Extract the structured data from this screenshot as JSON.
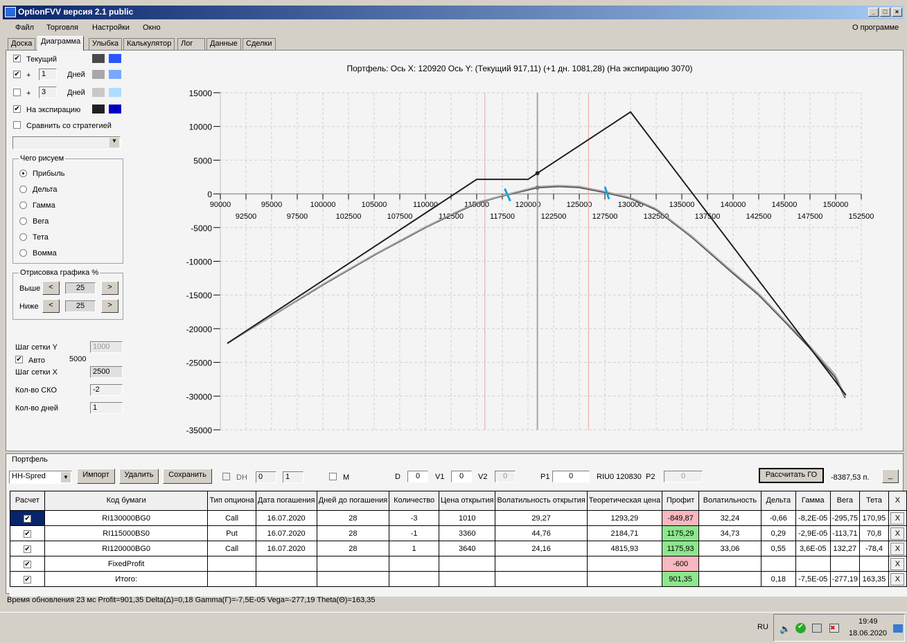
{
  "window": {
    "title": "OptionFVV версия 2.1 public",
    "min": "_",
    "max": "□",
    "close": "×"
  },
  "menu": [
    "Файл",
    "Торговля",
    "Настройки",
    "Окно"
  ],
  "about": "О программе",
  "tabs": [
    "Доска",
    "Диаграмма",
    "Улыбка",
    "Калькулятор",
    "Лог",
    "Данные",
    "Сделки"
  ],
  "active_tab": "Диаграмма",
  "left": {
    "current": {
      "label": "Текущий",
      "checked": true,
      "colors": [
        "#4a4a4a",
        "#2a55ff"
      ]
    },
    "plus1": {
      "plus": "+",
      "days": "1",
      "unit": "Дней",
      "checked": true,
      "colors": [
        "#a8a8a8",
        "#78a8ff"
      ]
    },
    "plus3": {
      "plus": "+",
      "days": "3",
      "unit": "Дней",
      "checked": false,
      "colors": [
        "#c8c8c8",
        "#b0dcff"
      ]
    },
    "expiry": {
      "label": "На экспирацию",
      "checked": true,
      "colors": [
        "#202020",
        "#0000c0"
      ]
    },
    "compare": {
      "label": "Сравнить со стратегией",
      "checked": false
    },
    "draw_group": {
      "title": "Чего рисуем",
      "options": [
        "Прибыль",
        "Дельта",
        "Гамма",
        "Вега",
        "Тета",
        "Вомма"
      ],
      "selected": "Прибыль"
    },
    "range_group": {
      "title": "Отрисовка графика %",
      "above": "Выше",
      "below": "Ниже",
      "above_val": "25",
      "below_val": "25",
      "dec": "<",
      "inc": ">"
    },
    "grid_y_label": "Шаг сетки Y",
    "grid_y": "1000",
    "auto_label": "Авто",
    "auto_checked": true,
    "auto_val": "5000",
    "grid_x_label": "Шаг сетки X",
    "grid_x": "2500",
    "sko_label": "Кол-во СКО",
    "sko": "-2",
    "days_label": "Кол-во дней",
    "days": "1"
  },
  "chart_data": {
    "type": "line",
    "title": "Портфель:  Ось X: 120920 Ось Y:  (Текущий 917,11)  (+1 дн. 1081,28)  (На экспирацию 3070)",
    "xlim": [
      90000,
      152500
    ],
    "ylim": [
      -35000,
      15000
    ],
    "x_ticks_top": [
      90000,
      95000,
      100000,
      105000,
      110000,
      115000,
      120000,
      125000,
      130000,
      135000,
      140000,
      145000,
      150000
    ],
    "x_ticks_bottom": [
      92500,
      97500,
      102500,
      107500,
      112500,
      117500,
      122500,
      127500,
      132500,
      137500,
      142500,
      147500,
      152500
    ],
    "y_ticks": [
      15000,
      10000,
      5000,
      0,
      -5000,
      -10000,
      -15000,
      -20000,
      -25000,
      -30000,
      -35000
    ],
    "grid": true,
    "cursor_x": 120920,
    "sigma_lines": [
      115800,
      125900
    ],
    "blue_marks": [
      118000,
      127700
    ],
    "series": [
      {
        "key": "expiry",
        "color": "#202020",
        "points": [
          [
            90676,
            -22170
          ],
          [
            115000,
            2150
          ],
          [
            120000,
            2150
          ],
          [
            130000,
            12150
          ],
          [
            151000,
            -29850
          ]
        ]
      },
      {
        "key": "plus1",
        "color": "#a8a8a8",
        "points": [
          [
            90676,
            -22170
          ],
          [
            95000,
            -18100
          ],
          [
            100000,
            -13400
          ],
          [
            105000,
            -9000
          ],
          [
            110000,
            -4900
          ],
          [
            112500,
            -3050
          ],
          [
            115000,
            -1300
          ],
          [
            117500,
            -250
          ],
          [
            120920,
            1081
          ],
          [
            123000,
            1250
          ],
          [
            125000,
            1100
          ],
          [
            127500,
            350
          ],
          [
            130000,
            -550
          ],
          [
            132500,
            -2200
          ],
          [
            136000,
            -6300
          ],
          [
            140000,
            -11600
          ],
          [
            142500,
            -14800
          ],
          [
            145000,
            -18700
          ],
          [
            147500,
            -22600
          ],
          [
            150000,
            -26900
          ],
          [
            151000,
            -30300
          ]
        ]
      },
      {
        "key": "current",
        "color": "#4a4a4a",
        "points": [
          [
            90676,
            -22170
          ],
          [
            95000,
            -18150
          ],
          [
            100000,
            -13500
          ],
          [
            105000,
            -9100
          ],
          [
            110000,
            -5000
          ],
          [
            112500,
            -3150
          ],
          [
            115000,
            -1400
          ],
          [
            117500,
            -320
          ],
          [
            120920,
            917
          ],
          [
            123000,
            1100
          ],
          [
            125000,
            950
          ],
          [
            127500,
            200
          ],
          [
            130000,
            -680
          ],
          [
            132500,
            -2350
          ],
          [
            136000,
            -6460
          ],
          [
            140000,
            -11800
          ],
          [
            142500,
            -15000
          ],
          [
            145000,
            -18900
          ],
          [
            147500,
            -22900
          ],
          [
            150000,
            -27300
          ],
          [
            151000,
            -30500
          ]
        ]
      }
    ],
    "markers": [
      [
        120920,
        3070
      ],
      [
        120920,
        917
      ]
    ]
  },
  "portfolio": {
    "title": "Портфель",
    "strategy": "HH-Spred",
    "import": "Импорт",
    "delete": "Удалить",
    "save": "Сохранить",
    "dh": "DH",
    "dh_checked": false,
    "spin1": "0",
    "spin2": "1",
    "m": "M",
    "m_checked": false,
    "d_label": "D",
    "d": "0",
    "v1_label": "V1",
    "v1": "0",
    "v2_label": "V2",
    "v2": "0",
    "p1_label": "P1",
    "p1": "0",
    "underlying": "RIU0 120830",
    "p2_label": "P2",
    "p2": "0",
    "calc_go": "Рассчитать ГО",
    "go_value": "-8387,53 п.",
    "minimize": "_",
    "columns": [
      "Расчет",
      "Код бумаги",
      "Тип опциона",
      "Дата погашения",
      "Дней до погашения",
      "Количество",
      "Цена открытия",
      "Волатильность открытия",
      "Теоретическая цена",
      "Профит",
      "Волатильность",
      "Дельта",
      "Гамма",
      "Вега",
      "Тета",
      "X"
    ],
    "rows": [
      [
        "RI130000BG0",
        "Call",
        "16.07.2020",
        "28",
        "-3",
        "1010",
        "29,27",
        "1293,29",
        "-849,87",
        "32,24",
        "-0,66",
        "-8,2E-05",
        "-295,75",
        "170,95"
      ],
      [
        "RI115000BS0",
        "Put",
        "16.07.2020",
        "28",
        "-1",
        "3360",
        "44,76",
        "2184,71",
        "1175,29",
        "34,73",
        "0,29",
        "-2,9E-05",
        "-113,71",
        "70,8"
      ],
      [
        "RI120000BG0",
        "Call",
        "16.07.2020",
        "28",
        "1",
        "3640",
        "24,16",
        "4815,93",
        "1175,93",
        "33,06",
        "0,55",
        "3,6E-05",
        "132,27",
        "-78,4"
      ],
      [
        "FixedProfit",
        "",
        "",
        "",
        "",
        "",
        "",
        "",
        "-600",
        "",
        "",
        "",
        "",
        ""
      ],
      [
        "Итого:",
        "",
        "",
        "",
        "",
        "",
        "",
        "",
        "901,35",
        "",
        "0,18",
        "-7,5E-05",
        "-277,19",
        "163,35"
      ]
    ],
    "profit_colors": {
      "negative": "#f7b8c0",
      "positive": "#8ee68e"
    }
  },
  "status": "Время обновления 23 мс  Profit=901,35 Delta(Δ)=0,18 Gamma(Γ)=-7,5E-05 Vega=-277,19 Theta(Θ)=163,35",
  "taskbar": {
    "lang": "RU",
    "time": "19:49",
    "date": "18.06.2020"
  }
}
